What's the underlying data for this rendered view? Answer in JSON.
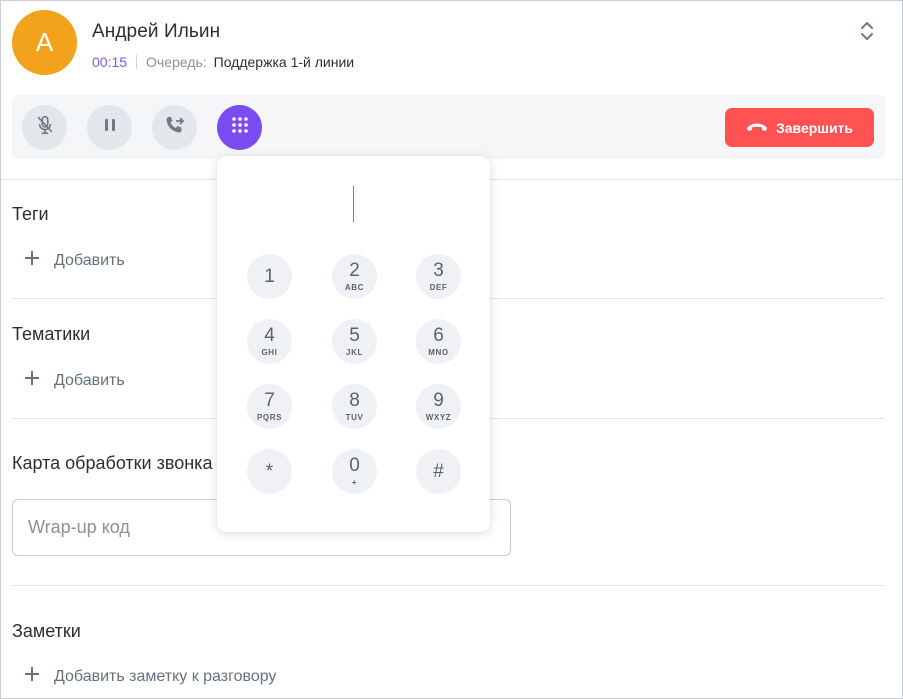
{
  "caller": {
    "avatar_letter": "А",
    "name": "Андрей Ильин",
    "timer": "00:15",
    "queue_label": "Очередь:",
    "queue_value": "Поддержка 1-й линии"
  },
  "controls": {
    "end_label": "Завершить"
  },
  "tags": {
    "title": "Теги",
    "add_label": "Добавить"
  },
  "topics": {
    "title": "Тематики",
    "add_label": "Добавить"
  },
  "call_card": {
    "title": "Карта обработки звонка",
    "wrapup_placeholder": "Wrap-up код",
    "wrapup_value": ""
  },
  "notes": {
    "title": "Заметки",
    "add_label": "Добавить заметку к разговору"
  },
  "dialpad": {
    "input_value": "",
    "keys": [
      {
        "digit": "1",
        "letters": ""
      },
      {
        "digit": "2",
        "letters": "ABC"
      },
      {
        "digit": "3",
        "letters": "DEF"
      },
      {
        "digit": "4",
        "letters": "GHI"
      },
      {
        "digit": "5",
        "letters": "JKL"
      },
      {
        "digit": "6",
        "letters": "MNO"
      },
      {
        "digit": "7",
        "letters": "PQRS"
      },
      {
        "digit": "8",
        "letters": "TUV"
      },
      {
        "digit": "9",
        "letters": "WXYZ"
      },
      {
        "digit": "*",
        "letters": ""
      },
      {
        "digit": "0",
        "letters": "+"
      },
      {
        "digit": "#",
        "letters": ""
      }
    ]
  },
  "colors": {
    "avatar": "#f2a21b",
    "accent": "#7a4cf2",
    "timer": "#7b5cf0",
    "end_call": "#ff5252"
  }
}
